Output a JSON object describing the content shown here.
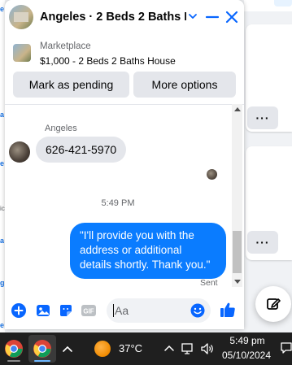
{
  "chat": {
    "title": "Angeles · 2 Beds 2 Baths H…",
    "listing": {
      "source": "Marketplace",
      "title": "$1,000 - 2 Beds 2 Baths House",
      "mark_pending_label": "Mark as pending",
      "more_options_label": "More options"
    },
    "messages": {
      "sender_name": "Angeles",
      "incoming_text": "626-421-5970",
      "timestamp": "5:49 PM",
      "outgoing_text": "\"I'll provide you with the address or additional details shortly. Thank you.\"",
      "status": "Sent"
    },
    "composer": {
      "placeholder": "Aa"
    },
    "colors": {
      "accent": "#0a7cff",
      "icon": "#0866ff"
    }
  },
  "taskbar": {
    "temperature": "37°C",
    "time": "5:49 pm",
    "date": "05/10/2024"
  },
  "icons": {
    "header": [
      "chevron-down-icon",
      "minimize-icon",
      "close-icon"
    ],
    "composer": [
      "add-icon",
      "photo-icon",
      "sticker-icon",
      "gif-icon",
      "emoji-icon",
      "thumbs-up-icon"
    ],
    "tray": [
      "chevron-up-icon",
      "network-icon",
      "volume-icon",
      "notification-icon"
    ]
  }
}
